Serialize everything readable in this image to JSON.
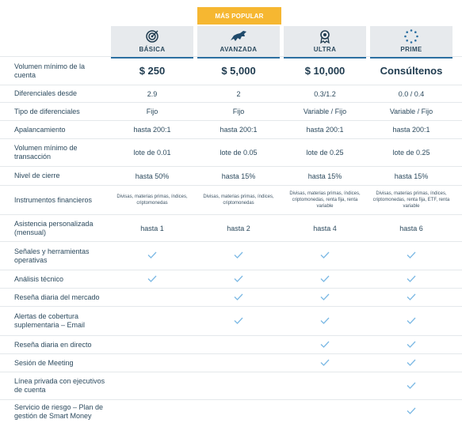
{
  "popular_badge": "Más popular",
  "plans": [
    {
      "name": "BÁSICA",
      "icon": "target-icon"
    },
    {
      "name": "AVANZADA",
      "icon": "bull-icon"
    },
    {
      "name": "ULTRA",
      "icon": "medal-icon"
    },
    {
      "name": "PRIME",
      "icon": "star-circle-icon"
    }
  ],
  "rows": [
    {
      "label": "Volumen mínimo de la cuenta",
      "values": [
        "$ 250",
        "$ 5,000",
        "$ 10,000",
        "Consúltenos"
      ]
    },
    {
      "label": "Diferenciales desde",
      "values": [
        "2.9",
        "2",
        "0.3/1.2",
        "0.0 / 0.4"
      ]
    },
    {
      "label": "Tipo de diferenciales",
      "values": [
        "Fijo",
        "Fijo",
        "Variable / Fijo",
        "Variable / Fijo"
      ]
    },
    {
      "label": "Apalancamiento",
      "values": [
        "hasta 200:1",
        "hasta 200:1",
        "hasta 200:1",
        "hasta 200:1"
      ]
    },
    {
      "label": "Volumen mínimo de transacción",
      "values": [
        "lote de 0.01",
        "lote de 0.05",
        "lote de 0.25",
        "lote de 0.25"
      ]
    },
    {
      "label": "Nivel de cierre",
      "values": [
        "hasta 50%",
        "hasta 15%",
        "hasta 15%",
        "hasta 15%"
      ]
    },
    {
      "label": "Instrumentos financieros",
      "values": [
        "Divisas, materias primas, índices, criptomonedas",
        "Divisas, materias primas, índices, criptomonedas",
        "Divisas, materias primas, índices, criptomonedas, renta fija, renta variable",
        "Divisas, materias primas, índices, criptomonedas, renta fija, ETF, renta variable"
      ]
    },
    {
      "label": "Asistencia personalizada (mensual)",
      "values": [
        "hasta 1",
        "hasta 2",
        "hasta 4",
        "hasta 6"
      ]
    },
    {
      "label": "Señales y herramientas operativas",
      "checks": [
        true,
        true,
        true,
        true
      ]
    },
    {
      "label": "Análisis técnico",
      "checks": [
        true,
        true,
        true,
        true
      ]
    },
    {
      "label": "Reseña diaria del mercado",
      "checks": [
        false,
        true,
        true,
        true
      ]
    },
    {
      "label": "Alertas de cobertura suplementaria – Email",
      "checks": [
        false,
        true,
        true,
        true
      ]
    },
    {
      "label": "Reseña diaria en directo",
      "checks": [
        false,
        false,
        true,
        true
      ]
    },
    {
      "label": "Sesión de Meeting",
      "checks": [
        false,
        false,
        true,
        true
      ]
    },
    {
      "label": "Línea privada con ejecutivos de cuenta",
      "checks": [
        false,
        false,
        false,
        true
      ]
    },
    {
      "label": "Servicio de riesgo – Plan de gestión de Smart Money",
      "checks": [
        false,
        false,
        false,
        true
      ]
    }
  ],
  "colors": {
    "accent": "#2c6fa1",
    "check": "#7ab8e4",
    "badge": "#f6b731",
    "header_bg": "#e7eaed"
  }
}
